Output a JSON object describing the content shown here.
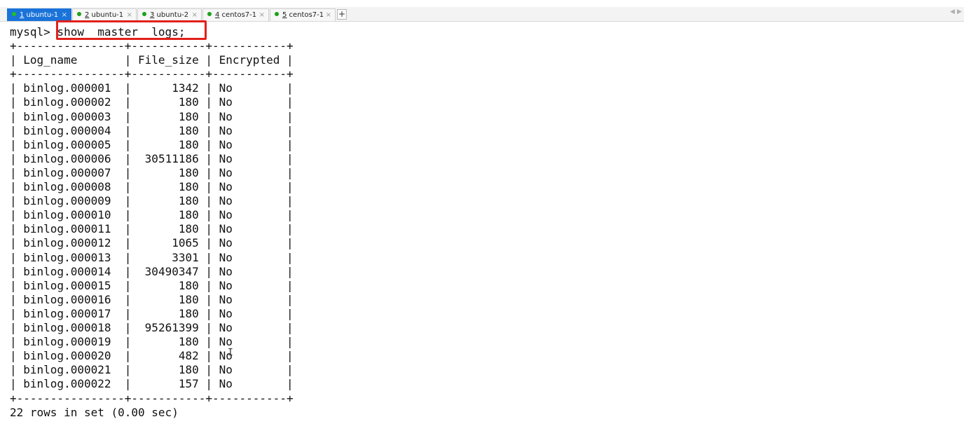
{
  "tabs": [
    {
      "num": "1",
      "label": " ubuntu-1",
      "active": true
    },
    {
      "num": "2",
      "label": " ubuntu-1",
      "active": false
    },
    {
      "num": "3",
      "label": " ubuntu-2",
      "active": false
    },
    {
      "num": "4",
      "label": " centos7-1",
      "active": false
    },
    {
      "num": "5",
      "label": " centos7-1",
      "active": false
    }
  ],
  "tab_close_glyph": "×",
  "tab_add_glyph": "+",
  "tab_scroll_left": "◀",
  "tab_scroll_right": "▶",
  "terminal": {
    "prompt": "mysql>",
    "command": " show  master  logs;",
    "border": "+----------------+-----------+-----------+",
    "columns": [
      "Log_name",
      "File_size",
      "Encrypted"
    ],
    "rows": [
      [
        "binlog.000001",
        "1342",
        "No"
      ],
      [
        "binlog.000002",
        "180",
        "No"
      ],
      [
        "binlog.000003",
        "180",
        "No"
      ],
      [
        "binlog.000004",
        "180",
        "No"
      ],
      [
        "binlog.000005",
        "180",
        "No"
      ],
      [
        "binlog.000006",
        "30511186",
        "No"
      ],
      [
        "binlog.000007",
        "180",
        "No"
      ],
      [
        "binlog.000008",
        "180",
        "No"
      ],
      [
        "binlog.000009",
        "180",
        "No"
      ],
      [
        "binlog.000010",
        "180",
        "No"
      ],
      [
        "binlog.000011",
        "180",
        "No"
      ],
      [
        "binlog.000012",
        "1065",
        "No"
      ],
      [
        "binlog.000013",
        "3301",
        "No"
      ],
      [
        "binlog.000014",
        "30490347",
        "No"
      ],
      [
        "binlog.000015",
        "180",
        "No"
      ],
      [
        "binlog.000016",
        "180",
        "No"
      ],
      [
        "binlog.000017",
        "180",
        "No"
      ],
      [
        "binlog.000018",
        "95261399",
        "No"
      ],
      [
        "binlog.000019",
        "180",
        "No"
      ],
      [
        "binlog.000020",
        "482",
        "No"
      ],
      [
        "binlog.000021",
        "180",
        "No"
      ],
      [
        "binlog.000022",
        "157",
        "No"
      ]
    ],
    "footer": "22 rows in set (0.00 sec)"
  },
  "colors": {
    "active_tab": "#1a73d9",
    "highlight_box": "#e3201b",
    "status_dot": "#1aa31a"
  }
}
